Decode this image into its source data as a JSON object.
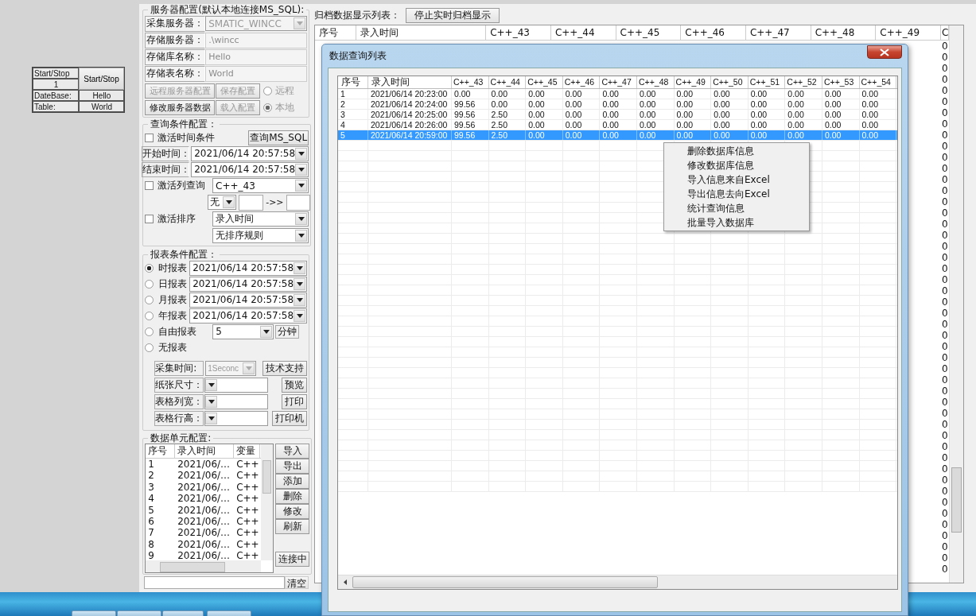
{
  "mini_table": {
    "status_label": "Start/Stop",
    "counter": "1",
    "toggle_button": "Start/Stop",
    "database_label": "DateBase:",
    "database_value": "Hello",
    "table_label": "Table:",
    "table_value": "World"
  },
  "server_config": {
    "title": "服务器配置(默认本地连接MS_SQL):",
    "fields": [
      {
        "label": "采集服务器：",
        "value": "SMATIC_WINCC",
        "kind": "combo",
        "disabled": true
      },
      {
        "label": "存储服务器：",
        "value": ".\\wincc",
        "kind": "text",
        "disabled": true
      },
      {
        "label": "存储库名称：",
        "value": "Hello",
        "kind": "text",
        "disabled": true
      },
      {
        "label": "存储表名称：",
        "value": "World",
        "kind": "text",
        "disabled": true
      }
    ],
    "action_rows": [
      {
        "buttons": [
          {
            "label": "远程服务器配置",
            "disabled": true
          },
          {
            "label": "保存配置",
            "disabled": true
          }
        ],
        "radio": {
          "label": "远程",
          "selected": false,
          "disabled": true
        }
      },
      {
        "buttons": [
          {
            "label": "修改服务器数据",
            "disabled": false
          },
          {
            "label": "载入配置",
            "disabled": true
          }
        ],
        "radio": {
          "label": "本地",
          "selected": true,
          "disabled": true
        }
      }
    ]
  },
  "query_config": {
    "title": "查询条件配置：",
    "time_filter": {
      "label": "激活时间条件",
      "checked": false
    },
    "query_button": "查询MS_SQL",
    "start": {
      "label": "开始时间：",
      "value": "2021/06/14 20:57:58"
    },
    "end": {
      "label": "结束时间：",
      "value": "2021/06/14 20:57:58"
    },
    "column_filter": {
      "label": "激活列查询",
      "checked": false,
      "column": "C++_43",
      "operator": "无",
      "arrow": "->>"
    },
    "sort": {
      "label": "激活排序",
      "checked": false,
      "column": "录入时间",
      "rule": "无排序规则"
    }
  },
  "report_config": {
    "title": "报表条件配置：",
    "reports": [
      {
        "label": "时报表",
        "selected": true,
        "kind": "date",
        "value": "2021/06/14 20:57:58"
      },
      {
        "label": "日报表",
        "selected": false,
        "kind": "date",
        "value": "2021/06/14 20:57:58"
      },
      {
        "label": "月报表",
        "selected": false,
        "kind": "date",
        "value": "2021/06/14 20:57:58"
      },
      {
        "label": "年报表",
        "selected": false,
        "kind": "date",
        "value": "2021/06/14 20:57:58"
      },
      {
        "label": "自由报表",
        "selected": false,
        "kind": "free",
        "value": "5",
        "unit": "分钟"
      },
      {
        "label": "无报表",
        "selected": false,
        "kind": "none"
      }
    ],
    "settings": [
      {
        "label": "采集时间:",
        "value": "1Seconc",
        "disabled": true,
        "button": "技术支持"
      },
      {
        "label": "纸张尺寸：",
        "disabled": false,
        "button": "预览"
      },
      {
        "label": "表格列宽：",
        "disabled": false,
        "button": "打印"
      },
      {
        "label": "表格行高：",
        "disabled": false,
        "button": "打印机"
      }
    ]
  },
  "data_units": {
    "title": "数据单元配置:",
    "columns": [
      "序号",
      "录入时间",
      "变量"
    ],
    "rows": [
      [
        "1",
        "2021/06/…",
        "C++"
      ],
      [
        "2",
        "2021/06/…",
        "C++"
      ],
      [
        "3",
        "2021/06/…",
        "C++"
      ],
      [
        "4",
        "2021/06/…",
        "C++"
      ],
      [
        "5",
        "2021/06/…",
        "C++"
      ],
      [
        "6",
        "2021/06/…",
        "C++"
      ],
      [
        "7",
        "2021/06/…",
        "C++"
      ],
      [
        "8",
        "2021/06/…",
        "C++"
      ],
      [
        "9",
        "2021/06/…",
        "C++"
      ]
    ],
    "buttons": [
      "导入",
      "导出",
      "添加",
      "删除",
      "修改",
      "刷新"
    ],
    "status_button": "连接中",
    "clear_button": "清空"
  },
  "archive": {
    "label": "归档数据显示列表：",
    "stop_button": "停止实时归档显示",
    "columns": [
      "序号",
      "录入时间",
      "C++_43",
      "C++_44",
      "C++_45",
      "C++_46",
      "C++_47",
      "C++_48",
      "C++_49",
      "C"
    ],
    "last_column_values": [
      "0",
      "0",
      "0",
      "0",
      "0",
      "0",
      "0",
      "0",
      "0",
      "0",
      "0",
      "0",
      "0",
      "0",
      "0",
      "0",
      "0",
      "0",
      "0",
      "0",
      "0",
      "0",
      "0",
      "0",
      "0",
      "0",
      "0",
      "0",
      "0",
      "0",
      "0",
      "0",
      "0",
      "0",
      "0",
      "0",
      "0",
      "0",
      "0",
      "0",
      "0",
      "0",
      "0",
      "0",
      "0",
      "0",
      "0",
      "0"
    ]
  },
  "dialog": {
    "title": "数据查询列表",
    "columns": [
      "序号",
      "录入时间",
      "C++_43",
      "C++_44",
      "C++_45",
      "C++_46",
      "C++_47",
      "C++_48",
      "C++_49",
      "C++_50",
      "C++_51",
      "C++_52",
      "C++_53",
      "C++_54"
    ],
    "rows": [
      {
        "cells": [
          "1",
          "2021/06/14 20:23:00",
          "0.00",
          "0.00",
          "0.00",
          "0.00",
          "0.00",
          "0.00",
          "0.00",
          "0.00",
          "0.00",
          "0.00",
          "0.00",
          "0.00"
        ],
        "selected": false
      },
      {
        "cells": [
          "2",
          "2021/06/14 20:24:00",
          "99.56",
          "0.00",
          "0.00",
          "0.00",
          "0.00",
          "0.00",
          "0.00",
          "0.00",
          "0.00",
          "0.00",
          "0.00",
          "0.00"
        ],
        "selected": false
      },
      {
        "cells": [
          "3",
          "2021/06/14 20:25:00",
          "99.56",
          "2.50",
          "0.00",
          "0.00",
          "0.00",
          "0.00",
          "0.00",
          "0.00",
          "0.00",
          "0.00",
          "0.00",
          "0.00"
        ],
        "selected": false
      },
      {
        "cells": [
          "4",
          "2021/06/14 20:26:00",
          "99.56",
          "2.50",
          "0.00",
          "0.00",
          "0.00",
          "0.00",
          "0.00",
          "0.00",
          "0.00",
          "0.00",
          "0.00",
          "0.00"
        ],
        "selected": false
      },
      {
        "cells": [
          "5",
          "2021/06/14 20:59:00",
          "99.56",
          "2.50",
          "0.00",
          "0.00",
          "0.00",
          "0.00",
          "0.00",
          "0.00",
          "0.00",
          "0.00",
          "0.00",
          "0.00"
        ],
        "selected": true
      }
    ],
    "context_menu": [
      "删除数据库信息",
      "修改数据库信息",
      "导入信息来自Excel",
      "导出信息去向Excel",
      "统计查询信息",
      "批量导入数据库"
    ]
  }
}
